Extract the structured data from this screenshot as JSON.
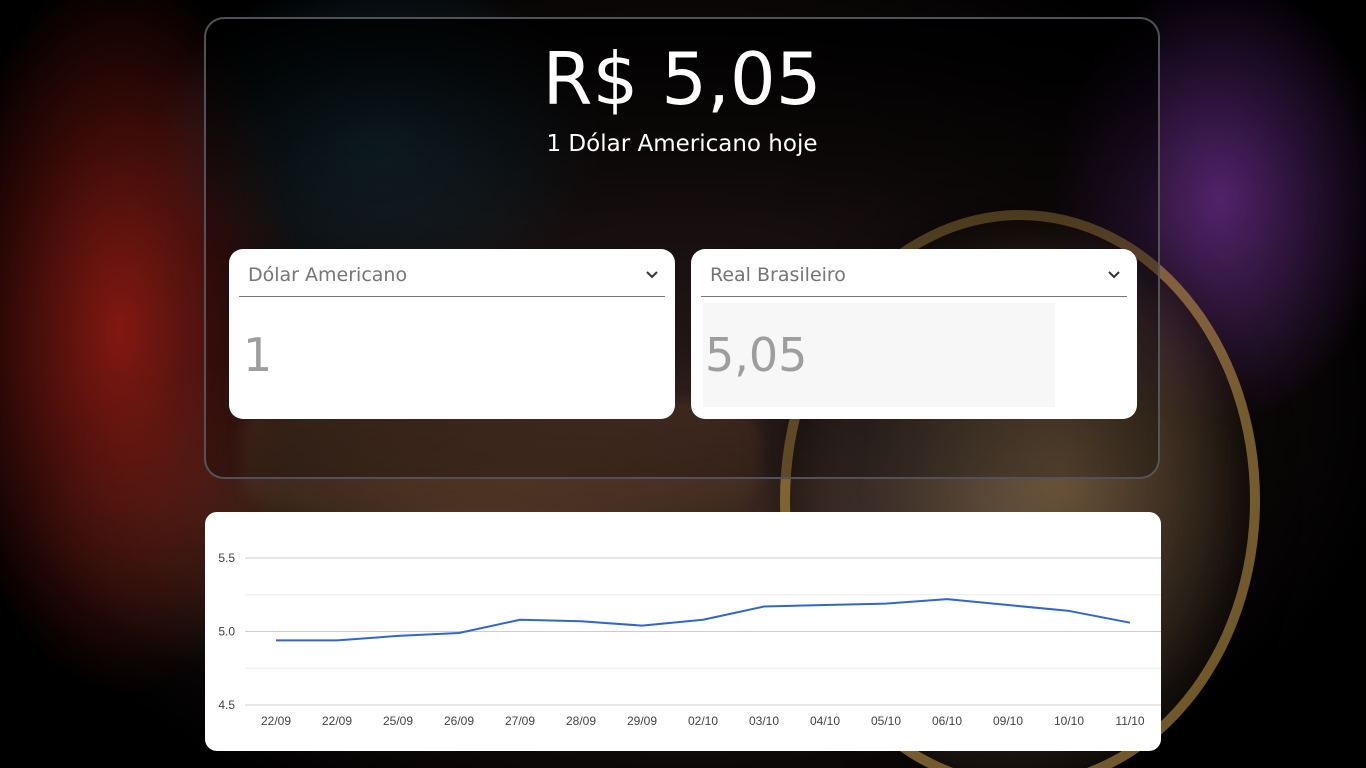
{
  "header": {
    "rate_value": "R$ 5,05",
    "rate_description": "1 Dólar Americano hoje"
  },
  "converter": {
    "from": {
      "currency": "Dólar Americano",
      "amount": "1"
    },
    "to": {
      "currency": "Real Brasileiro",
      "amount": "5,05"
    }
  },
  "icons": {
    "select_arrow": "chevron-down-icon"
  },
  "colors": {
    "line": "#3366cc",
    "text_light": "#ffffff",
    "placeholder": "#9e9e9e"
  },
  "chart_data": {
    "type": "line",
    "categories": [
      "22/09",
      "22/09",
      "25/09",
      "26/09",
      "27/09",
      "28/09",
      "29/09",
      "02/10",
      "03/10",
      "04/10",
      "05/10",
      "06/10",
      "09/10",
      "10/10",
      "11/10"
    ],
    "series": [
      {
        "values": [
          4.94,
          4.94,
          4.97,
          4.99,
          5.08,
          5.07,
          5.04,
          5.08,
          5.17,
          5.18,
          5.19,
          5.22,
          5.18,
          5.14,
          5.06
        ]
      }
    ],
    "yticks": [
      "4.5",
      "5.0",
      "5.5"
    ],
    "ylim": [
      4.5,
      5.5
    ],
    "grid": true,
    "legend": "none",
    "color": "#3366cc"
  }
}
